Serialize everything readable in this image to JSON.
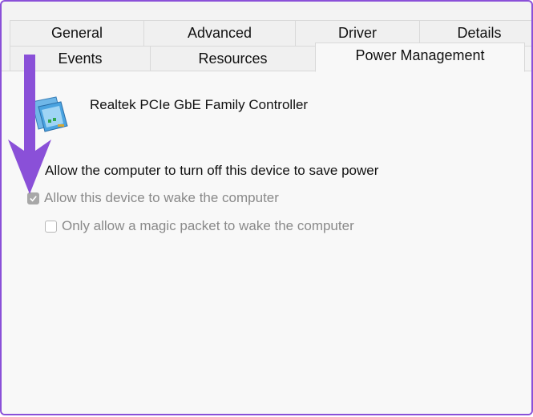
{
  "tabs": {
    "row_top": [
      {
        "label": "General"
      },
      {
        "label": "Advanced"
      },
      {
        "label": "Driver"
      },
      {
        "label": "Details"
      }
    ],
    "row_bottom": [
      {
        "label": "Events"
      },
      {
        "label": "Resources"
      },
      {
        "label": "Power Management",
        "active": true
      }
    ]
  },
  "device": {
    "name": "Realtek PCIe GbE Family Controller",
    "icon": "network-adapter-icon"
  },
  "options": [
    {
      "label": "Allow the computer to turn off this device to save power",
      "checked": false,
      "enabled": true
    },
    {
      "label": "Allow this device to wake the computer",
      "checked": true,
      "enabled": false
    },
    {
      "label": "Only allow a magic packet to wake the computer",
      "checked": false,
      "enabled": false
    }
  ],
  "colors": {
    "frame_border": "#8a50d8",
    "annotation_arrow": "#8a50d8"
  }
}
